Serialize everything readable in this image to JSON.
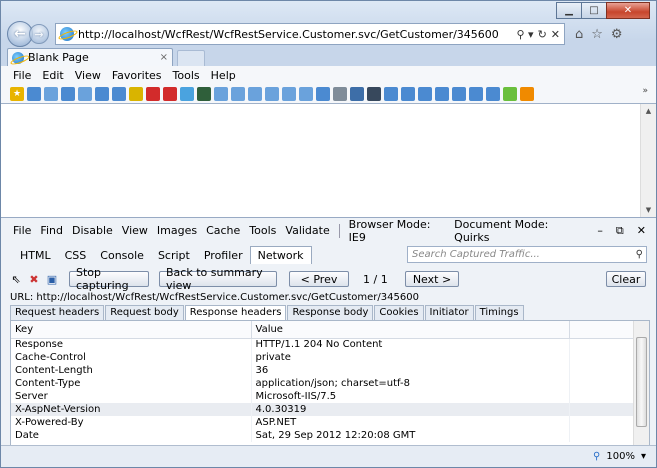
{
  "browser": {
    "address": "http://localhost/WcfRest/WcfRestService.Customer.svc/GetCustomer/345600",
    "address_icons": [
      "search-icon",
      "refresh-icon",
      "stop-icon"
    ],
    "tab_title": "Blank Page",
    "tab_close": "×",
    "menu": [
      "File",
      "Edit",
      "View",
      "Favorites",
      "Tools",
      "Help"
    ],
    "zoom": "100%"
  },
  "devtools": {
    "menu": {
      "file": "File",
      "find": "Find",
      "disable": "Disable",
      "view": "View",
      "images": "Images",
      "cache": "Cache",
      "tools": "Tools",
      "validate": "Validate",
      "browser_mode": "Browser Mode: IE9",
      "document_mode": "Document Mode: Quirks"
    },
    "tabs": [
      "HTML",
      "CSS",
      "Console",
      "Script",
      "Profiler",
      "Network"
    ],
    "active_tab": "Network",
    "search_placeholder": "Search Captured Traffic...",
    "buttons": {
      "stop": "Stop capturing",
      "summary": "Back to summary view",
      "prev": "< Prev",
      "page": "1 / 1",
      "next": "Next >",
      "clear": "Clear"
    },
    "url_line": "URL: http://localhost/WcfRest/WcfRestService.Customer.svc/GetCustomer/345600",
    "subtabs": [
      "Request headers",
      "Request body",
      "Response headers",
      "Response body",
      "Cookies",
      "Initiator",
      "Timings"
    ],
    "active_subtab": "Response headers",
    "table": {
      "headers": [
        "Key",
        "Value"
      ],
      "rows": [
        [
          "Response",
          "HTTP/1.1 204 No Content"
        ],
        [
          "Cache-Control",
          "private"
        ],
        [
          "Content-Length",
          "36"
        ],
        [
          "Content-Type",
          "application/json; charset=utf-8"
        ],
        [
          "Server",
          "Microsoft-IIS/7.5"
        ],
        [
          "X-AspNet-Version",
          "4.0.30319"
        ],
        [
          "X-Powered-By",
          "ASP.NET"
        ],
        [
          "Date",
          "Sat, 29 Sep 2012 12:20:08 GMT"
        ]
      ]
    }
  }
}
